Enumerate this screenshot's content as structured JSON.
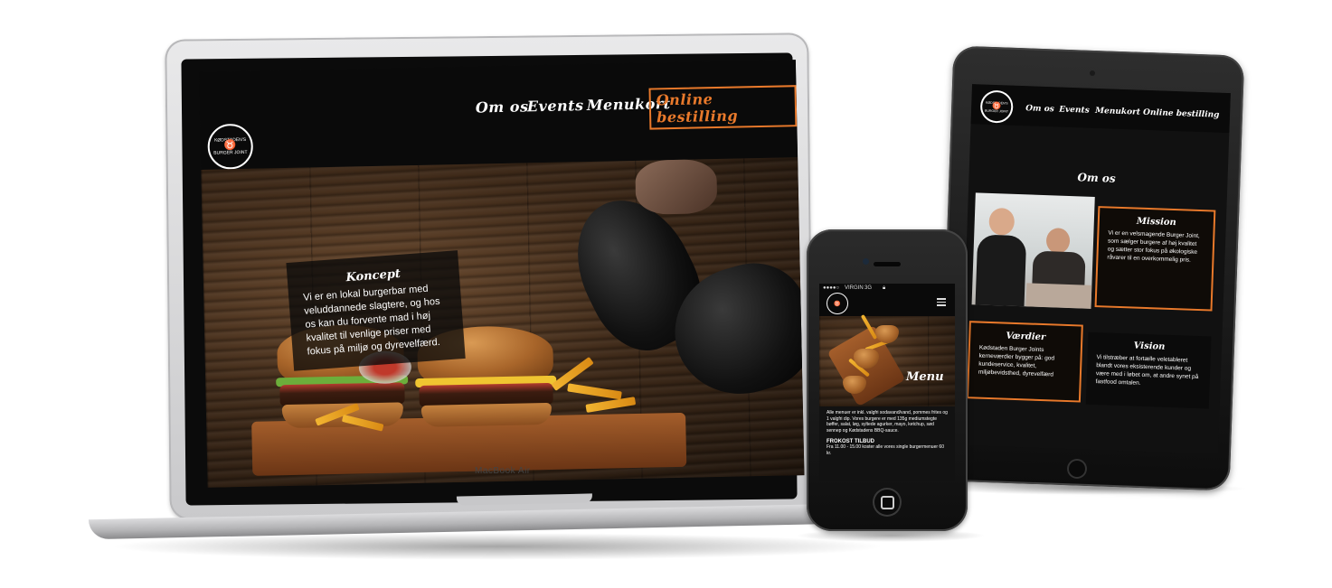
{
  "brand": {
    "logo_top": "KØDSTADEN'S",
    "logo_bottom": "BURGER JOINT",
    "accent_color": "#e8792b"
  },
  "laptop": {
    "device_label": "MacBook Air",
    "nav": {
      "items": [
        "Om os",
        "Events",
        "Menukort"
      ],
      "cta": "Online bestilling"
    },
    "concept": {
      "title": "Koncept",
      "text": "Vi er en lokal burgerbar med veluddannede slagtere, og hos os kan du forvente mad i høj kvalitet til venlige priser med fokus på miljø og dyrevelfærd."
    }
  },
  "phone": {
    "status": {
      "carrier": "VIRGIN",
      "network": "3G"
    },
    "menu_icon": "hamburger-menu-icon",
    "menu_title": "Menu",
    "menu_text": "Alle menuer er inkl. valgfri sodavand/vand, pommes frites og 1 valgfri dip. Vores burgere er med 135g mediumstegte bøffer, salat, løg, syltede agurker, mayo, ketchup, sød sennep og Kødstadens BBQ-sauce.",
    "offer_title": "FROKOST TILBUD",
    "offer_text": "Fra 11.00 - 15.00 koster alle vores single burgermenuer 60 kr."
  },
  "tablet": {
    "nav": {
      "items": [
        "Om os",
        "Events",
        "Menukort",
        "Online bestilling"
      ]
    },
    "section_title": "Om os",
    "mission": {
      "title": "Mission",
      "text": "Vi er en velsmagende Burger Joint, som sælger burgere af høj kvalitet og sætter stor fokus på økologiske råvarer til en overkommelig pris."
    },
    "values": {
      "title": "Værdier",
      "text": "Kødstaden Burger Joints kerneværdier bygger på: god kundeservice, kvalitet, miljøbevidsthed, dyrevelfærd"
    },
    "vision": {
      "title": "Vision",
      "text": "Vi tilstræber at fortælle veletableret blandt vores eksisterende kunder og være med i løbet om, at andre synet på fastfood omtalen."
    }
  }
}
